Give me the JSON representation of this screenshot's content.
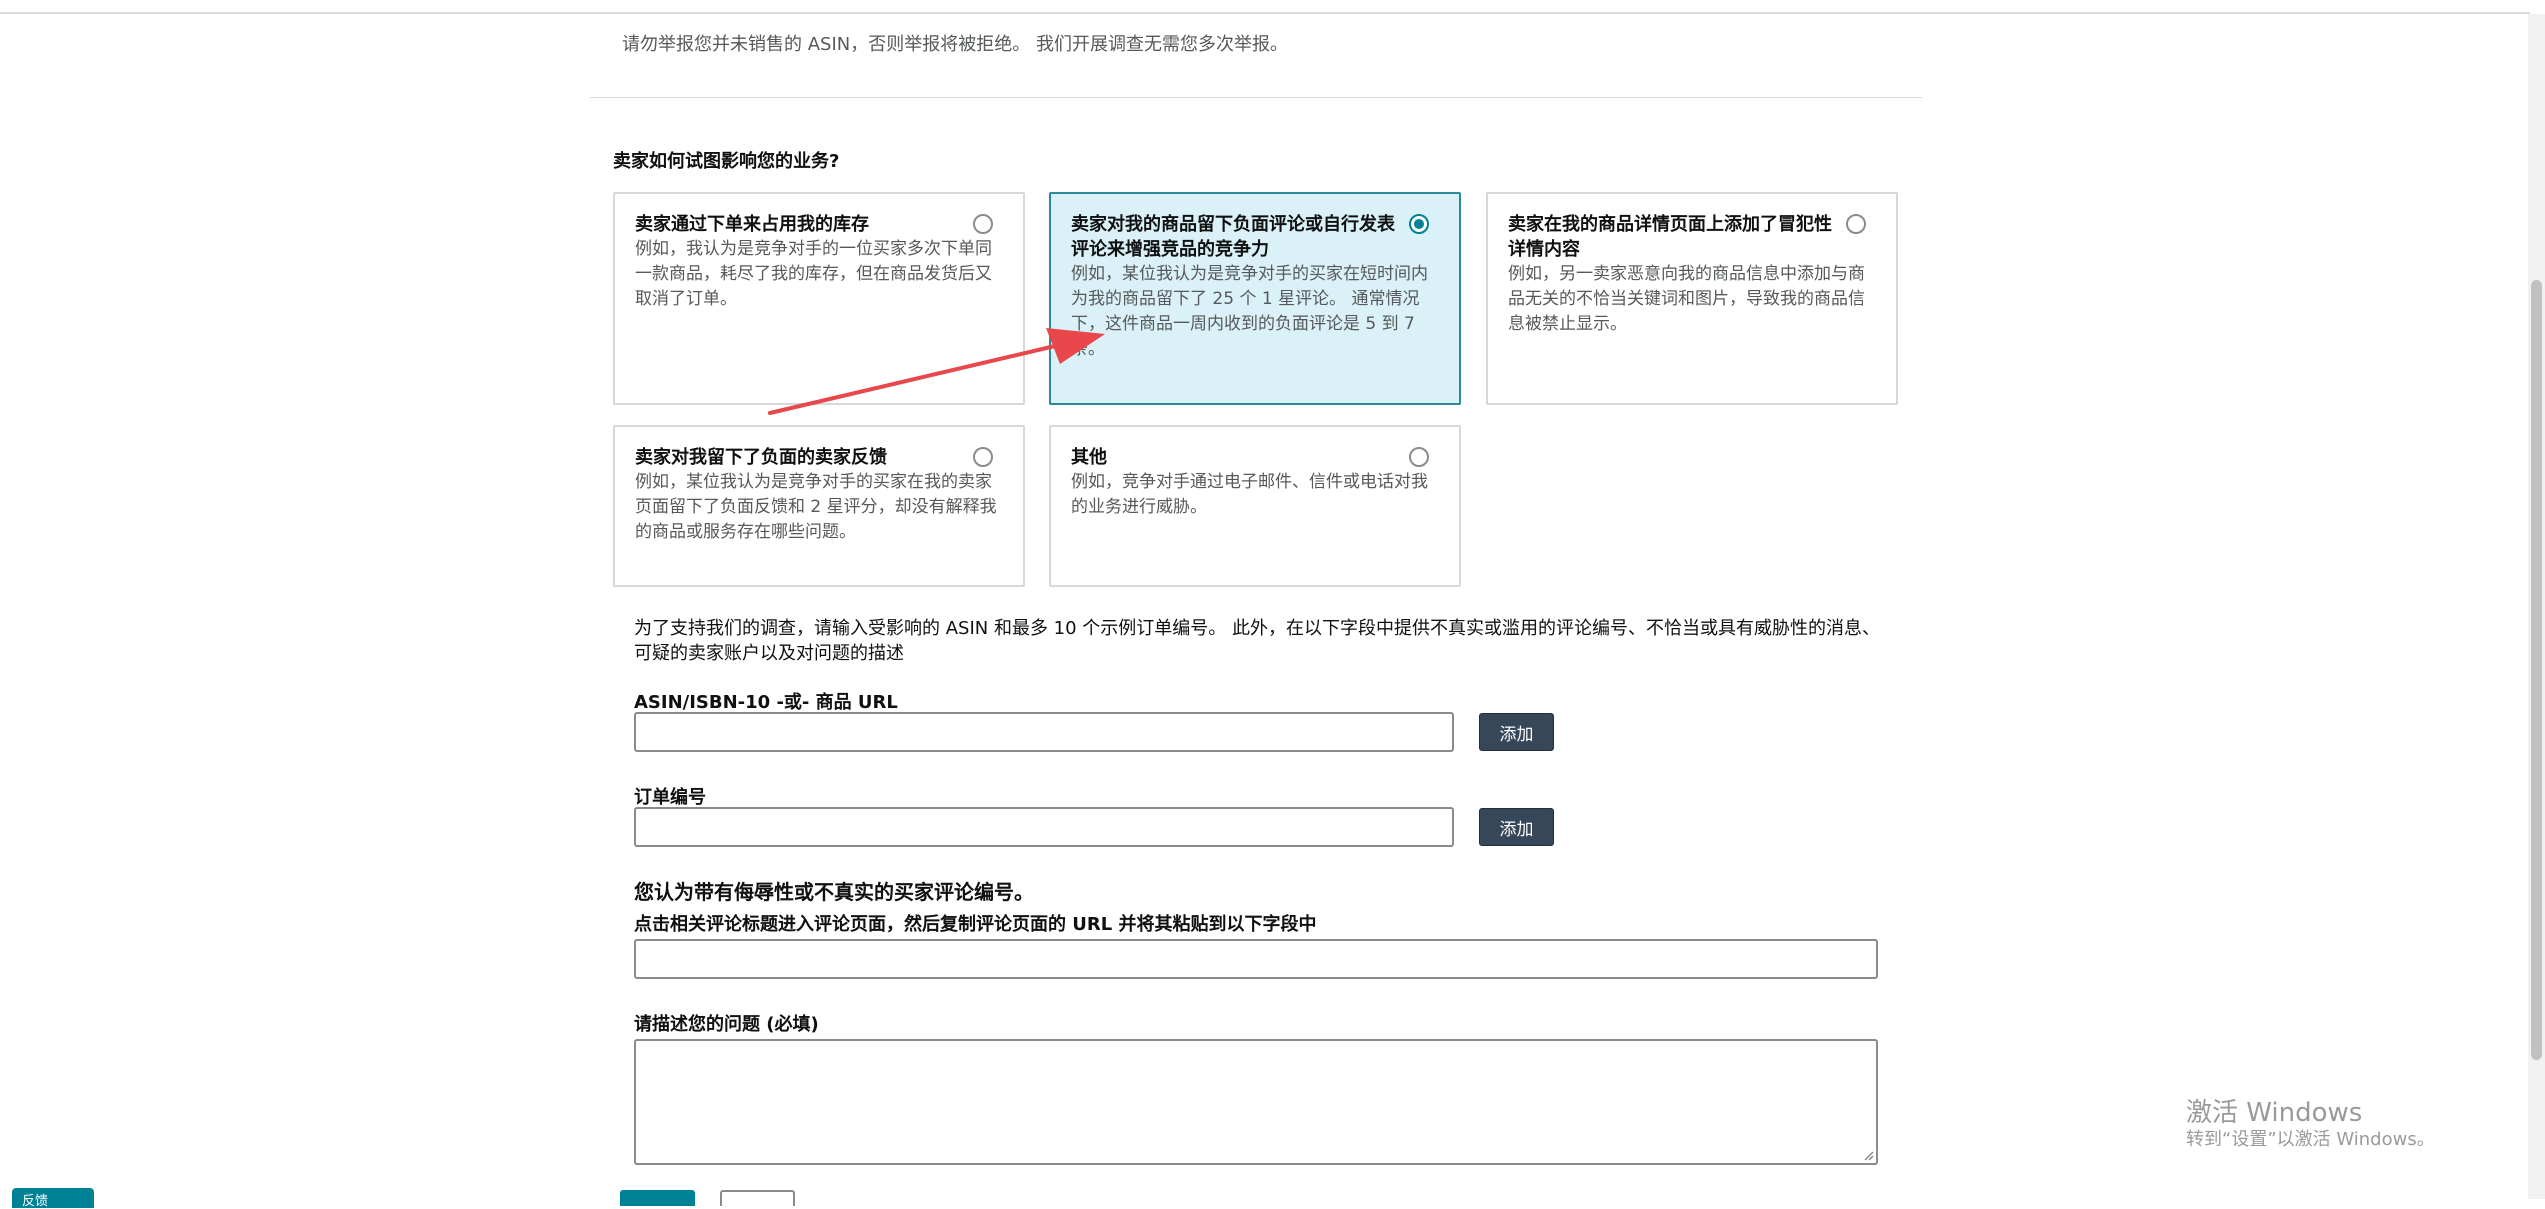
{
  "notice": "请勿举报您并未销售的 ASIN，否则举报将被拒绝。 我们开展调查无需您多次举报。",
  "question": "卖家如何试图影响您的业务?",
  "options": [
    {
      "title": "卖家通过下单来占用我的库存",
      "desc": "例如，我认为是竞争对手的一位买家多次下单同一款商品，耗尽了我的库存，但在商品发货后又取消了订单。",
      "selected": false
    },
    {
      "title": "卖家对我的商品留下负面评论或自行发表评论来增强竞品的竞争力",
      "desc": "例如，某位我认为是竞争对手的买家在短时间内为我的商品留下了 25 个 1 星评论。 通常情况下，这件商品一周内收到的负面评论是 5 到 7 条。",
      "selected": true
    },
    {
      "title": "卖家在我的商品详情页面上添加了冒犯性详情内容",
      "desc": "例如，另一卖家恶意向我的商品信息中添加与商品无关的不恰当关键词和图片，导致我的商品信息被禁止显示。",
      "selected": false
    },
    {
      "title": "卖家对我留下了负面的卖家反馈",
      "desc": "例如，某位我认为是竞争对手的买家在我的卖家页面留下了负面反馈和 2 星评分，却没有解释我的商品或服务存在哪些问题。",
      "selected": false
    },
    {
      "title": "其他",
      "desc": "例如，竞争对手通过电子邮件、信件或电话对我的业务进行威胁。",
      "selected": false
    }
  ],
  "instructions": "为了支持我们的调查，请输入受影响的 ASIN 和最多 10 个示例订单编号。 此外，在以下字段中提供不真实或滥用的评论编号、不恰当或具有威胁性的消息、可疑的卖家账户以及对问题的描述",
  "asin_label": "ASIN/ISBN-10 -或- 商品 URL",
  "order_label": "订单编号",
  "add_label": "添加",
  "review_heading": "您认为带有侮辱性或不真实的买家评论编号。",
  "review_subheading": "点击相关评论标题进入评论页面，然后复制评论页面的 URL 并将其粘贴到以下字段中",
  "describe_label": "请描述您的问题 (必填)",
  "watermark": {
    "line1": "激活 Windows",
    "line2": "转到“设置”以激活 Windows。"
  },
  "feedback_label": "反馈",
  "colors": {
    "accent": "#008296",
    "selected_bg": "#daf1f7",
    "arrow": "#e8474b",
    "button": "#37475a"
  }
}
